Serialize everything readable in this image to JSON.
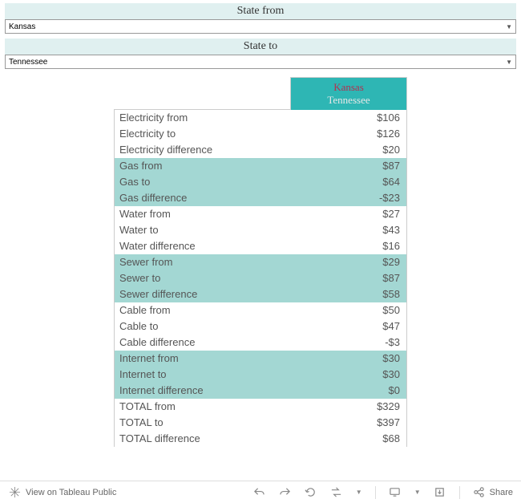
{
  "filters": {
    "from": {
      "label": "State  from",
      "value": "Kansas"
    },
    "to": {
      "label": "State  to",
      "value": "Tennessee"
    }
  },
  "header": {
    "line1": "Kansas",
    "line2": "Tennessee"
  },
  "rows": [
    {
      "label": "Electricity from",
      "value": "$106",
      "band": 0
    },
    {
      "label": "Electricity to",
      "value": "$126",
      "band": 0
    },
    {
      "label": "Electricity difference",
      "value": "$20",
      "band": 0
    },
    {
      "label": "Gas from",
      "value": "$87",
      "band": 1
    },
    {
      "label": "Gas to",
      "value": "$64",
      "band": 1
    },
    {
      "label": "Gas difference",
      "value": "-$23",
      "band": 1
    },
    {
      "label": "Water from",
      "value": "$27",
      "band": 0
    },
    {
      "label": "Water to",
      "value": "$43",
      "band": 0
    },
    {
      "label": "Water difference",
      "value": "$16",
      "band": 0
    },
    {
      "label": "Sewer from",
      "value": "$29",
      "band": 1
    },
    {
      "label": "Sewer to",
      "value": "$87",
      "band": 1
    },
    {
      "label": "Sewer difference",
      "value": "$58",
      "band": 1
    },
    {
      "label": "Cable from",
      "value": "$50",
      "band": 0
    },
    {
      "label": "Cable to",
      "value": "$47",
      "band": 0
    },
    {
      "label": "Cable difference",
      "value": "-$3",
      "band": 0
    },
    {
      "label": "Internet from",
      "value": "$30",
      "band": 1
    },
    {
      "label": "Internet to",
      "value": "$30",
      "band": 1
    },
    {
      "label": "Internet difference",
      "value": "$0",
      "band": 1
    },
    {
      "label": "TOTAL from",
      "value": "$329",
      "band": 0
    },
    {
      "label": "TOTAL to",
      "value": "$397",
      "band": 0
    },
    {
      "label": "TOTAL difference",
      "value": "$68",
      "band": 0
    }
  ],
  "toolbar": {
    "view_label": "View on Tableau Public",
    "share_label": "Share"
  }
}
